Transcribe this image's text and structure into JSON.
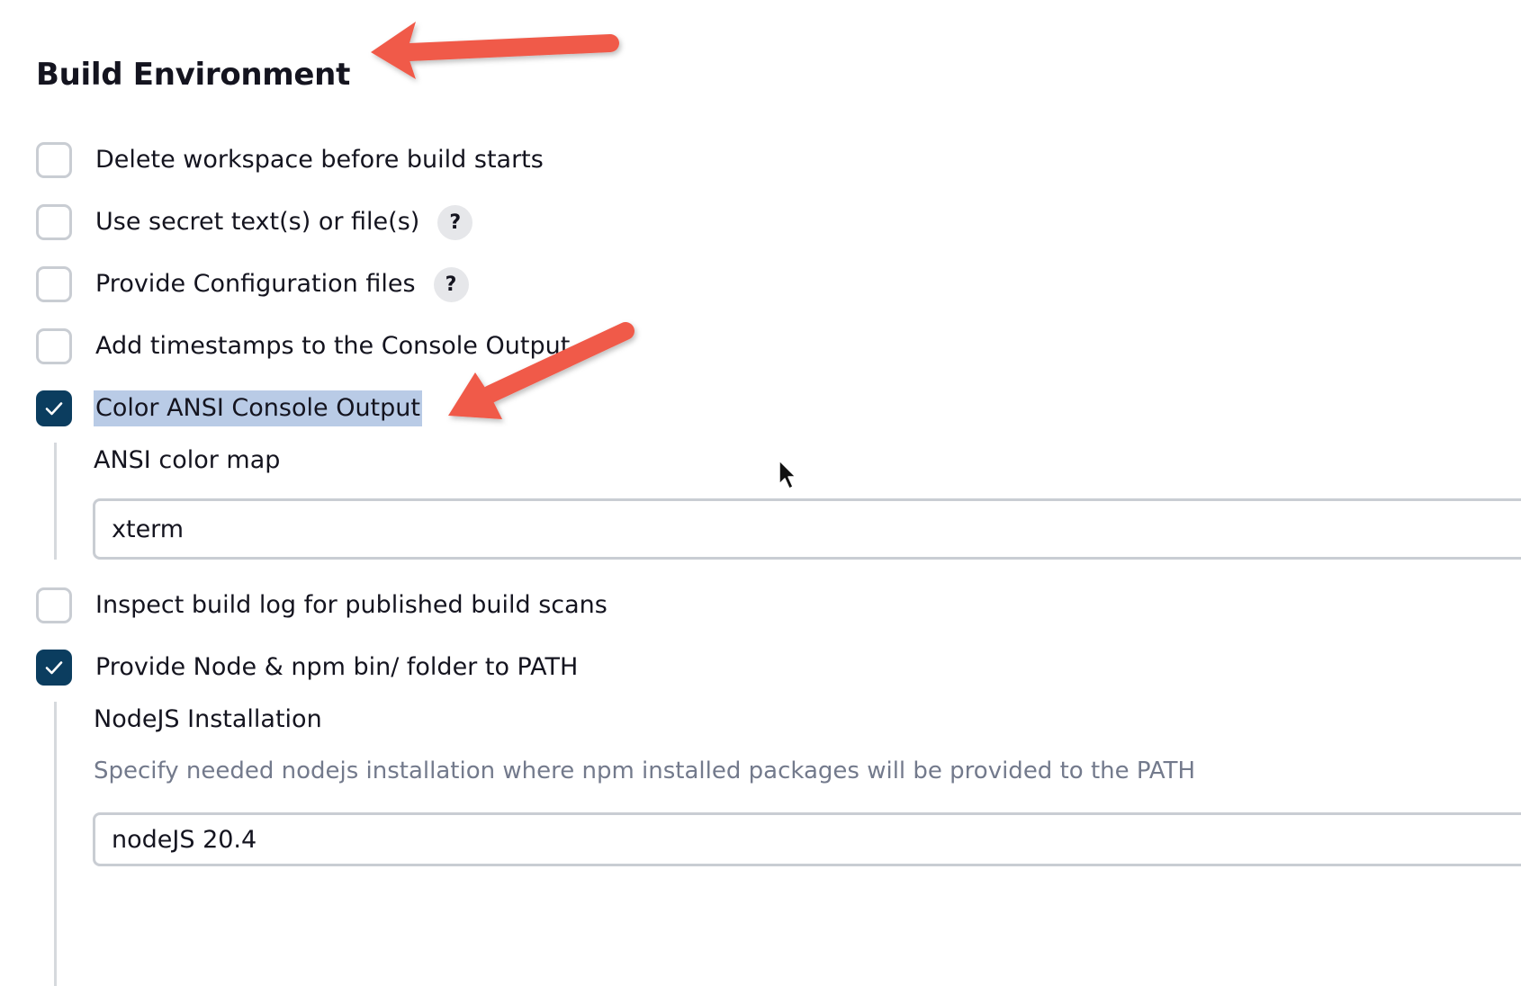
{
  "section": {
    "title": "Build Environment"
  },
  "options": {
    "delete_workspace": {
      "label": "Delete workspace before build starts",
      "checked": false
    },
    "secret_files": {
      "label": "Use secret text(s) or file(s)",
      "checked": false,
      "help": "?"
    },
    "config_files": {
      "label": "Provide Configuration files",
      "checked": false,
      "help": "?"
    },
    "timestamps": {
      "label": "Add timestamps to the Console Output",
      "checked": false
    },
    "ansi_color": {
      "label": "Color ANSI Console Output",
      "checked": true,
      "color_map_label": "ANSI color map",
      "color_map_value": "xterm"
    },
    "build_scans": {
      "label": "Inspect build log for published build scans",
      "checked": false
    },
    "node_path": {
      "label": "Provide Node & npm bin/ folder to PATH",
      "checked": true,
      "installation_label": "NodeJS Installation",
      "installation_description": "Specify needed nodejs installation where npm installed packages will be provided to the PATH",
      "installation_value": "nodeJS 20.4"
    }
  },
  "colors": {
    "checkbox_checked": "#0b3d5f",
    "text_highlight": "#b9cbe6",
    "annotation_arrow": "#f05a4a"
  }
}
